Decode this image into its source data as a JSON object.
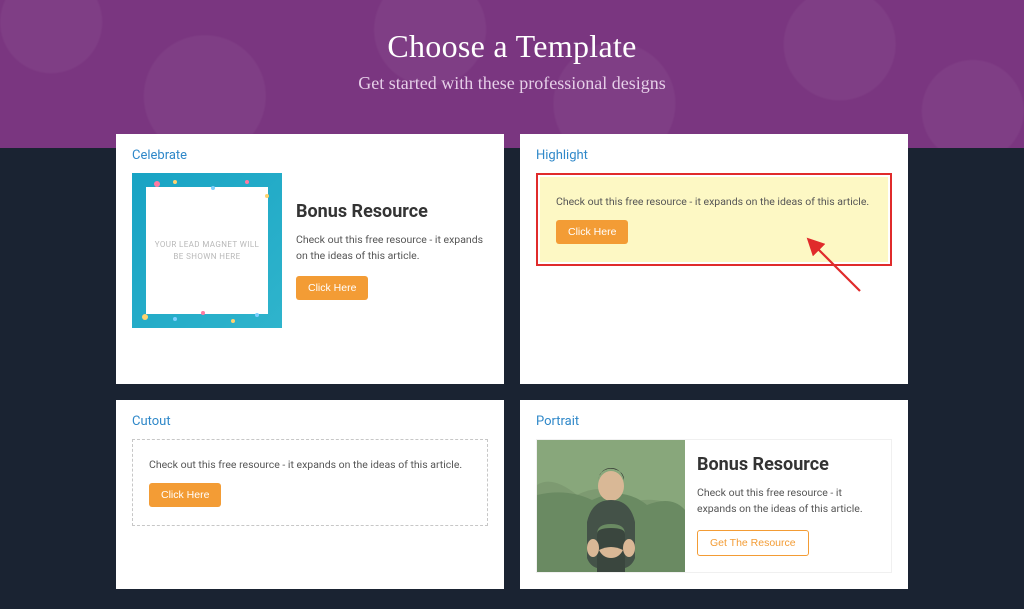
{
  "hero": {
    "title": "Choose a Template",
    "subtitle": "Get started with these professional designs"
  },
  "templates": {
    "celebrate": {
      "name": "Celebrate",
      "placeholder": "YOUR LEAD MAGNET WILL BE SHOWN HERE",
      "heading": "Bonus Resource",
      "desc": "Check out this free resource - it expands on the ideas of this article.",
      "button": "Click Here"
    },
    "highlight": {
      "name": "Highlight",
      "desc": "Check out this free resource - it expands on the ideas of this article.",
      "button": "Click Here"
    },
    "cutout": {
      "name": "Cutout",
      "desc": "Check out this free resource - it expands on the ideas of this article.",
      "button": "Click Here"
    },
    "portrait": {
      "name": "Portrait",
      "heading": "Bonus Resource",
      "desc": "Check out this free resource - it expands on the ideas of this article.",
      "button": "Get The Resource"
    }
  }
}
